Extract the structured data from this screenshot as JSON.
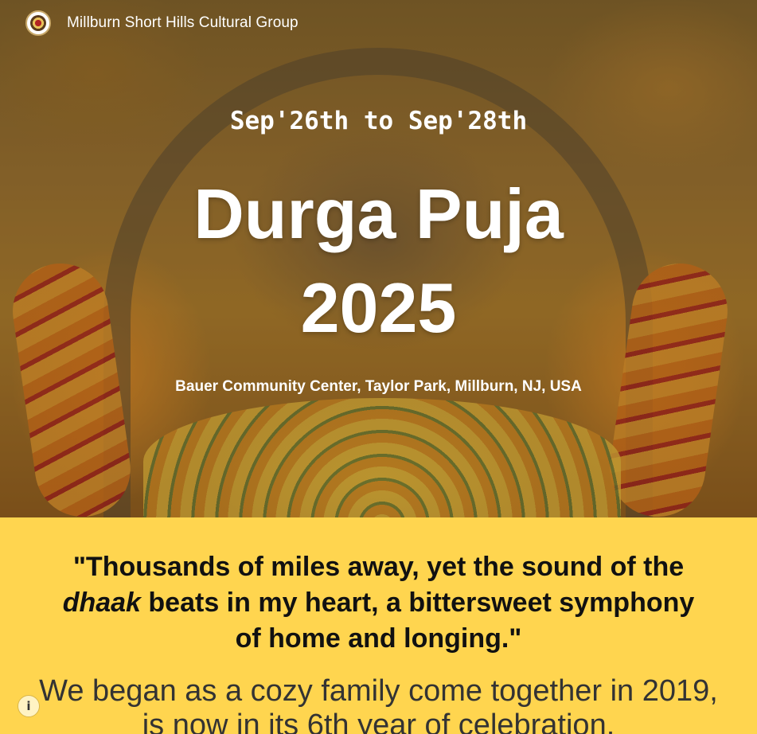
{
  "brand": {
    "name": "Millburn Short Hills Cultural Group",
    "logo_icon": "emblem-logo"
  },
  "hero": {
    "dates": "Sep'26th to Sep'28th",
    "title_line1": "Durga Puja",
    "title_line2": "2025",
    "venue": "Bauer Community Center, Taylor Park, Millburn, NJ, USA"
  },
  "quote": {
    "part1": "\"Thousands of miles away, yet the sound of the ",
    "emphasis": "dhaak",
    "part2": " beats in my heart, a bittersweet symphony of home and longing.\""
  },
  "intro": {
    "text": "We began as a cozy family come together in 2019, is now in its 6th year of celebration."
  },
  "info_button": {
    "icon": "info-icon",
    "glyph": "i"
  },
  "colors": {
    "accent": "#ffd54f",
    "hero_text": "#ffffff"
  }
}
